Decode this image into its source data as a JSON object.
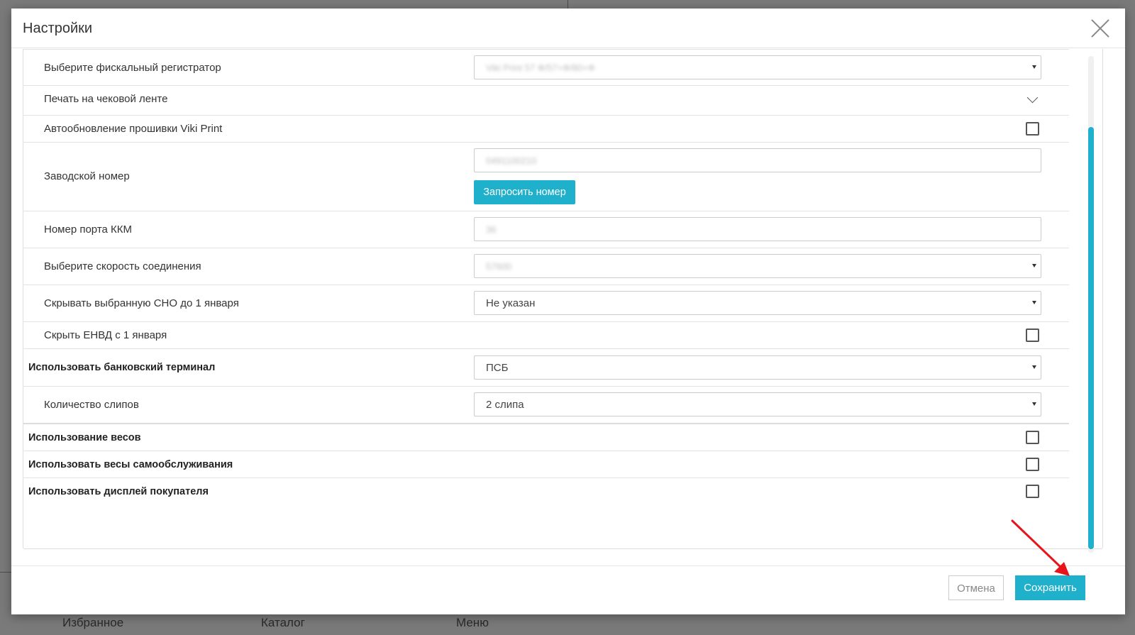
{
  "background": {
    "nav": [
      "Избранное",
      "Каталог",
      "Меню"
    ]
  },
  "modal": {
    "title": "Настройки",
    "rows": {
      "fiscal_registrar": {
        "label": "Выберите фискальный регистратор",
        "value": "Viki Print 57 Ф/57+Ф/80+Ф"
      },
      "receipt_tape": {
        "label": "Печать на чековой ленте"
      },
      "firmware_autoupdate": {
        "label": "Автообновление прошивки Viki Print"
      },
      "serial_number": {
        "label": "Заводской номер",
        "value": "0491100210",
        "button": "Запросить номер"
      },
      "kkm_port": {
        "label": "Номер порта ККМ",
        "value": "36"
      },
      "connection_speed": {
        "label": "Выберите скорость соединения",
        "value": "57600"
      },
      "hide_sno": {
        "label": "Скрывать выбранную СНО до 1 января",
        "value": "Не указан"
      },
      "hide_envd": {
        "label": "Скрыть ЕНВД с 1 января"
      },
      "bank_terminal": {
        "label": "Использовать банковский терминал",
        "value": "ПСБ"
      },
      "slip_count": {
        "label": "Количество слипов",
        "value": "2 слипа"
      },
      "scales": {
        "label": "Использование весов"
      },
      "self_service_scales": {
        "label": "Использовать весы самообслуживания"
      },
      "customer_display": {
        "label": "Использовать дисплей покупателя"
      }
    },
    "footer": {
      "cancel": "Отмена",
      "save": "Сохранить"
    }
  },
  "colors": {
    "accent": "#1fb1cc",
    "annotation_arrow": "#e8141c"
  }
}
